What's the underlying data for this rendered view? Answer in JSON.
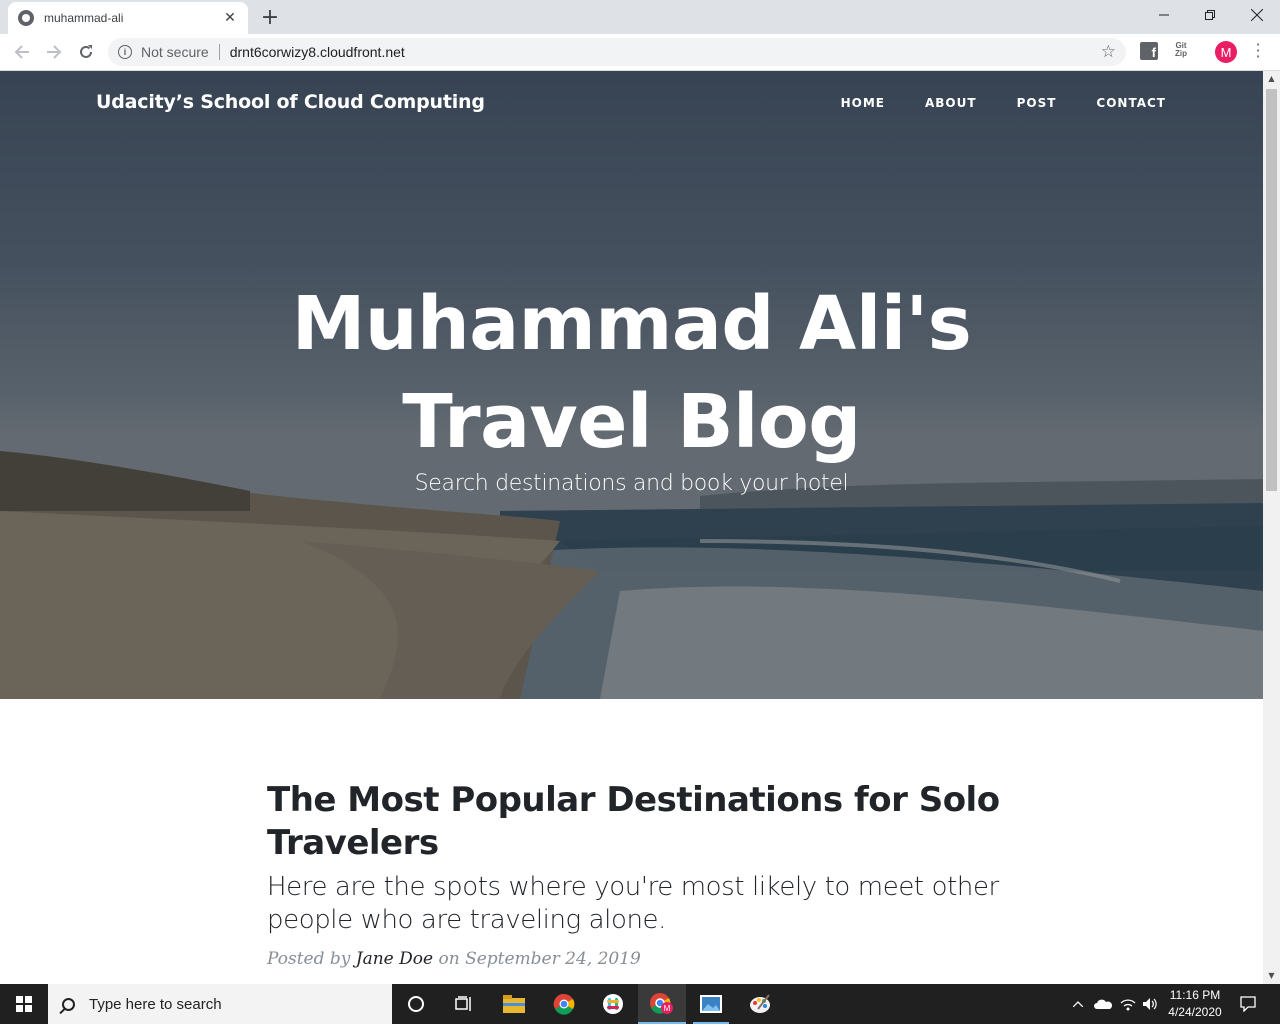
{
  "browser": {
    "tab_title": "muhammad-ali",
    "tab_close": "✕",
    "new_tab": "+",
    "security_label": "Not secure",
    "url": "drnt6corwizy8.cloudfront.net",
    "profile_initial": "M",
    "ext_zip_line1": "Git",
    "ext_zip_line2": "Zip"
  },
  "site": {
    "brand": "Udacity’s School of Cloud Computing",
    "nav": [
      "HOME",
      "ABOUT",
      "POST",
      "CONTACT"
    ],
    "hero_title_line1": "Muhammad Ali's",
    "hero_title_line2": "Travel Blog",
    "hero_subtitle": "Search destinations and book your hotel"
  },
  "post": {
    "title": "The Most Popular Destinations for Solo Travelers",
    "subtitle": "Here are the spots where you're most likely to meet other people who are traveling alone.",
    "meta_prefix": "Posted by",
    "author": "Jane Doe",
    "meta_date": "on September 24, 2019"
  },
  "taskbar": {
    "search_placeholder": "Type here to search",
    "time": "11:16 PM",
    "date": "4/24/2020",
    "apps": [
      "task-view",
      "file-explorer",
      "chrome",
      "slack",
      "chrome-profile",
      "photos",
      "paint"
    ]
  },
  "colors": {
    "accent_profile": "#e91e63",
    "taskbar_bg": "#202020",
    "text_dark": "#212529",
    "meta_gray": "#868e96"
  }
}
